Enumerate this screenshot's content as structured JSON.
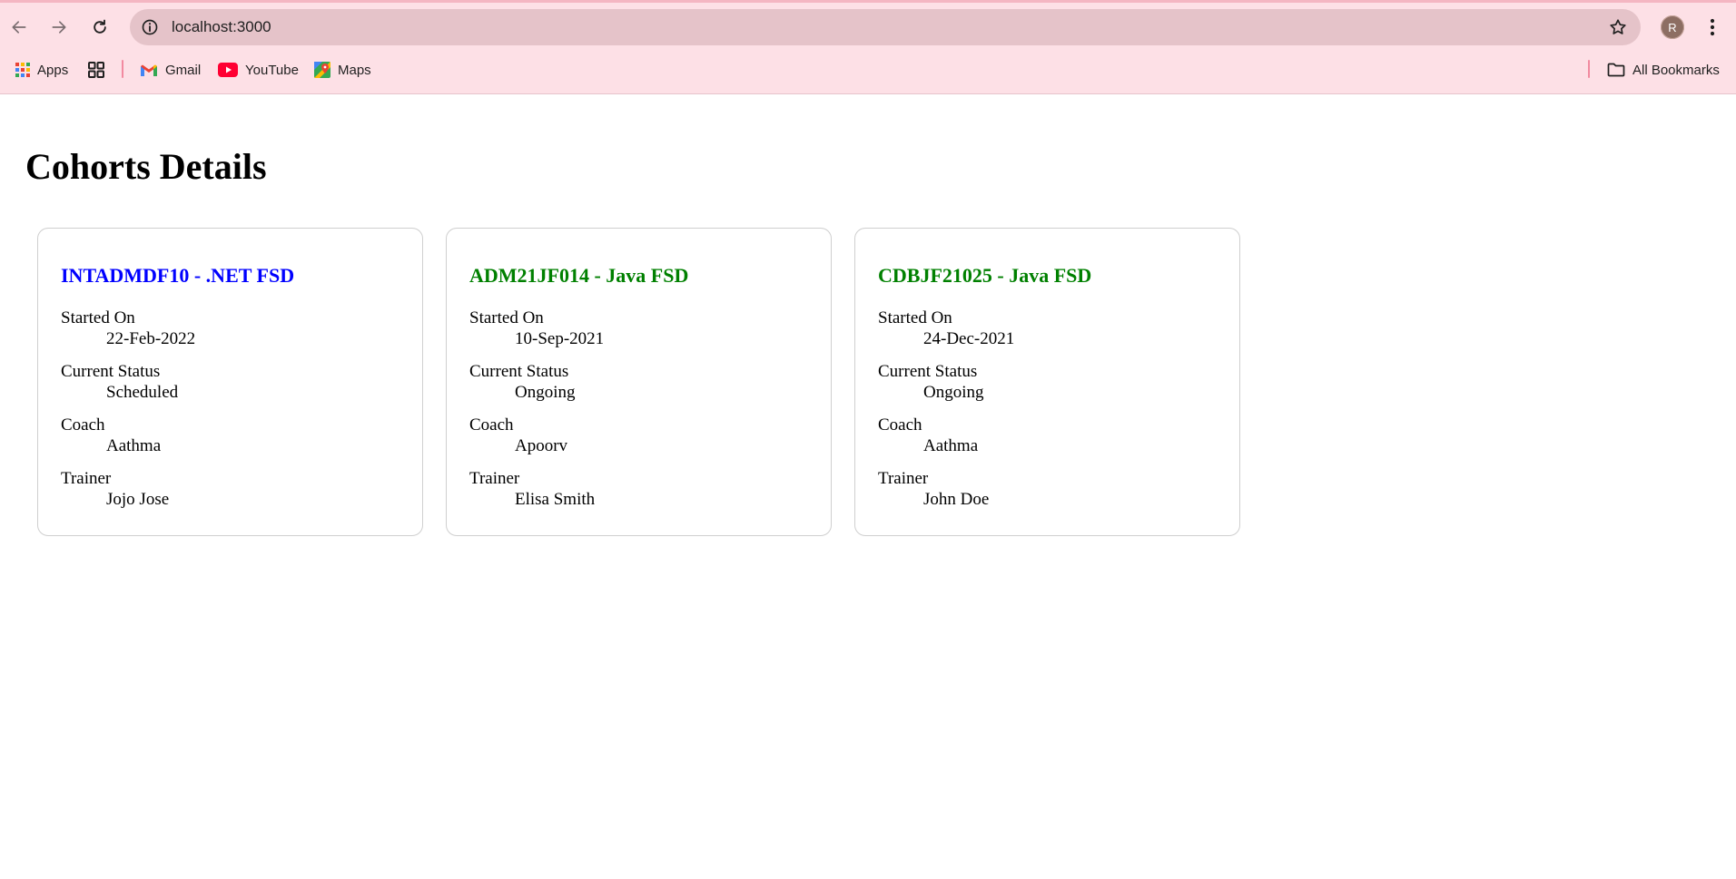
{
  "browser": {
    "url": "localhost:3000",
    "profile_initial": "R",
    "bookmarks": {
      "apps_label": "Apps",
      "gmail_label": "Gmail",
      "youtube_label": "YouTube",
      "maps_label": "Maps",
      "all_bookmarks_label": "All Bookmarks"
    }
  },
  "page": {
    "title": "Cohorts Details",
    "colors": {
      "scheduled_title": "#0000ff",
      "ongoing_title": "#008000"
    },
    "cohorts": [
      {
        "title": "INTADMDF10 - .NET FSD",
        "status_color": "#0000ff",
        "started_on_label": "Started On",
        "started_on": "22-Feb-2022",
        "status_label": "Current Status",
        "status": "Scheduled",
        "coach_label": "Coach",
        "coach": "Aathma",
        "trainer_label": "Trainer",
        "trainer": "Jojo Jose"
      },
      {
        "title": "ADM21JF014 - Java FSD",
        "status_color": "#008000",
        "started_on_label": "Started On",
        "started_on": "10-Sep-2021",
        "status_label": "Current Status",
        "status": "Ongoing",
        "coach_label": "Coach",
        "coach": "Apoorv",
        "trainer_label": "Trainer",
        "trainer": "Elisa Smith"
      },
      {
        "title": "CDBJF21025 - Java FSD",
        "status_color": "#008000",
        "started_on_label": "Started On",
        "started_on": "24-Dec-2021",
        "status_label": "Current Status",
        "status": "Ongoing",
        "coach_label": "Coach",
        "coach": "Aathma",
        "trainer_label": "Trainer",
        "trainer": "John Doe"
      }
    ]
  }
}
